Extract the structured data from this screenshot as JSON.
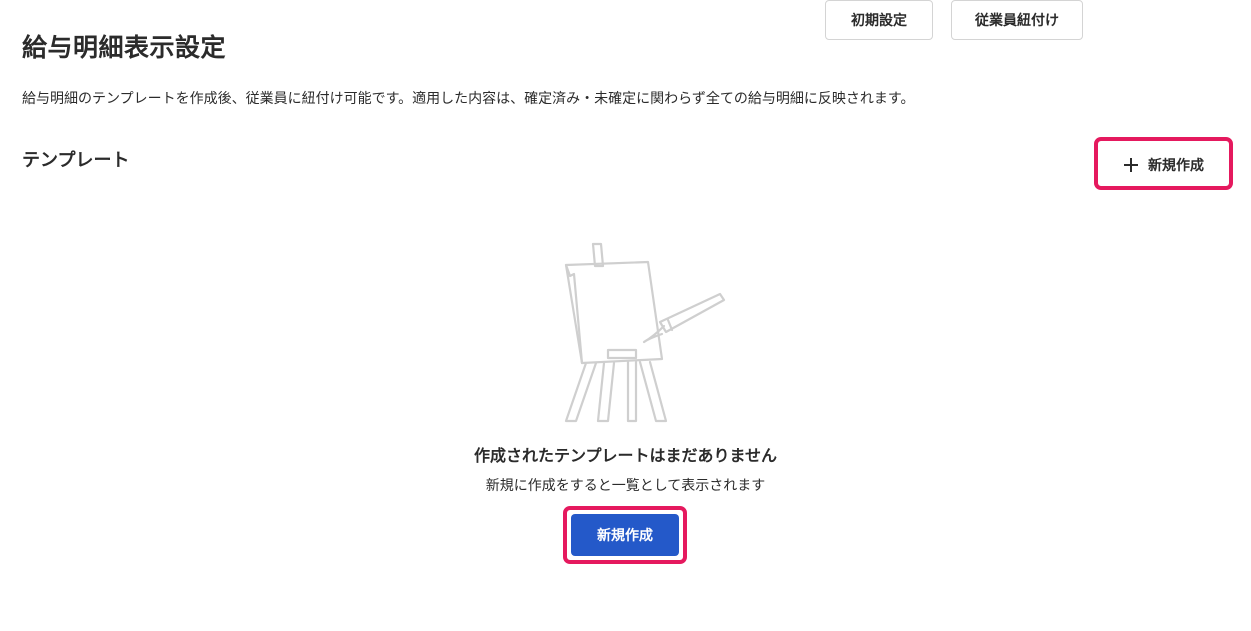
{
  "page": {
    "title": "給与明細表示設定",
    "description": "給与明細のテンプレートを作成後、従業員に紐付け可能です。適用した内容は、確定済み・未確定に関わらず全ての給与明細に反映されます。"
  },
  "templates": {
    "section_title": "テンプレート",
    "toolbar": {
      "initial_settings_label": "初期設定",
      "assign_employees_label": "従業員紐付け",
      "new_label": "新規作成",
      "new_icon": "plus-icon"
    },
    "empty_state": {
      "illustration": "easel-icon",
      "title": "作成されたテンプレートはまだありません",
      "description": "新規に作成をすると一覧として表示されます",
      "button_label": "新規作成"
    }
  },
  "colors": {
    "primary": "#2459c9",
    "highlight": "#e5195e",
    "text": "#2b2b2b",
    "border": "#d4d4d4"
  }
}
